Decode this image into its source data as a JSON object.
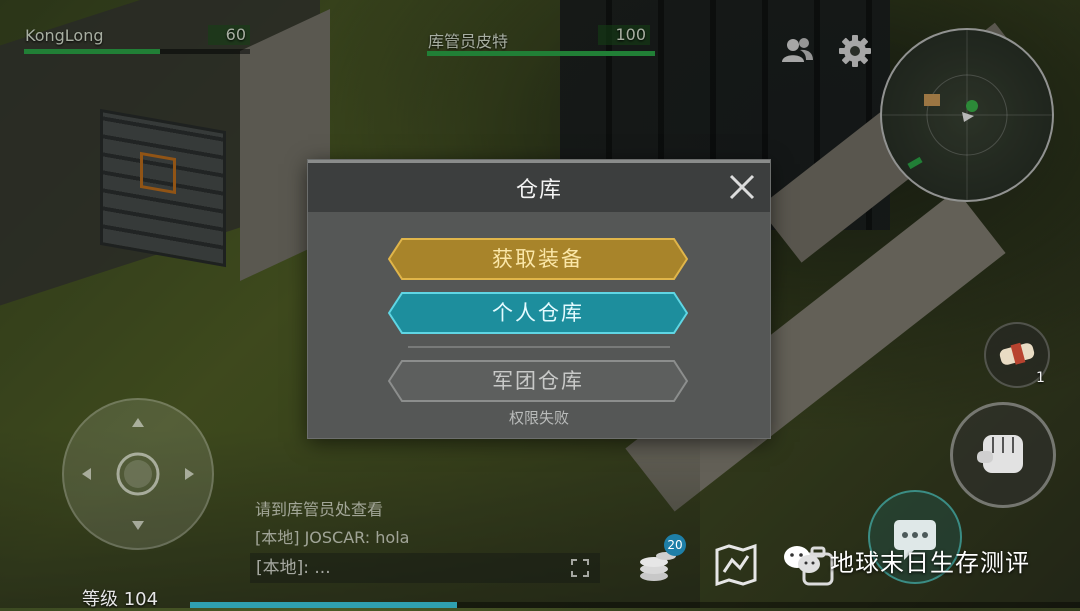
{
  "players": [
    {
      "name": "KongLong",
      "health": 60,
      "health_fraction": 0.6
    },
    {
      "name": "库管员皮特",
      "health": 100,
      "health_fraction": 1.0
    }
  ],
  "dialog": {
    "title": "仓库",
    "buttons": [
      {
        "label": "获取装备",
        "style": "gold"
      },
      {
        "label": "个人仓库",
        "style": "teal"
      },
      {
        "label": "军团仓库",
        "style": "disabled"
      }
    ],
    "permission_note": "权限失败"
  },
  "item_slot": {
    "count": "1"
  },
  "chat": {
    "lines": [
      "请到库管员处查看",
      "[本地] JOSCAR: hola"
    ],
    "input_placeholder": "[本地]: ..."
  },
  "player_level": "等级 104",
  "xp_fraction": 0.3,
  "coins_badge": "20",
  "watermark": "地球末日生存测评",
  "colors": {
    "gold": "#b0892a",
    "teal": "#1e93a3",
    "health": "#2fb04b",
    "dialog_bg": "#555756"
  },
  "icons": [
    "social-icon",
    "gear-icon",
    "minimap",
    "close-icon",
    "joystick",
    "bandage-icon",
    "fist-icon",
    "chat-icon",
    "coins-icon",
    "map-icon",
    "backpack-icon",
    "wechat-icon"
  ]
}
